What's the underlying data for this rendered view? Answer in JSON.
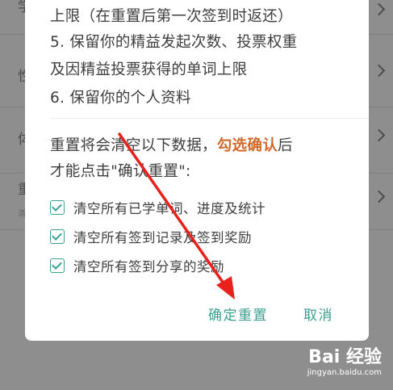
{
  "background": {
    "rows": [
      {
        "char": "学",
        "sub": ""
      },
      {
        "char": "性",
        "sub": ""
      },
      {
        "char": "体",
        "sub": ""
      },
      {
        "char": "重",
        "sub": "清"
      }
    ]
  },
  "dialog": {
    "lines": [
      "上限（在重置后第一次签到时返还）",
      "5. 保留你的精益发起次数、投票权重",
      "及因精益投票获得的单词上限",
      "6. 保留你的个人资料"
    ],
    "reset_text_a": "重置将会清空以下数据，",
    "reset_text_highlight": "勾选确认",
    "reset_text_b": "后",
    "reset_text_line2": "才能点击\"确认重置\":",
    "options": [
      {
        "label": "清空所有已学单词、进度及统计",
        "checked": true
      },
      {
        "label": "清空所有签到记录及签到奖励",
        "checked": true
      },
      {
        "label": "清空所有签到分享的奖励",
        "checked": true
      }
    ],
    "confirm_label": "确定重置",
    "cancel_label": "取消"
  },
  "colors": {
    "accent": "#3a9e8f",
    "highlight": "#d06a2a",
    "arrow": "#e8211c"
  },
  "watermark": {
    "logo": "Bai 经验",
    "url": "jingyan.baidu.com"
  }
}
